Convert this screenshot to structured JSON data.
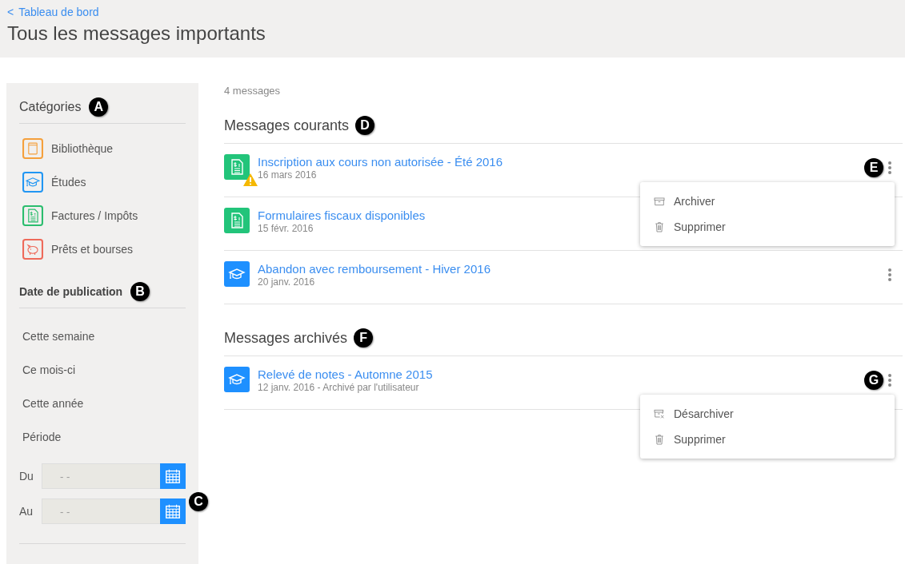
{
  "header": {
    "back_link": "Tableau de bord",
    "back_icon": "<",
    "title": "Tous les messages importants"
  },
  "sidebar": {
    "categories": {
      "title": "Catégories",
      "callout": "A",
      "items": [
        {
          "label": "Bibliothèque",
          "kind": "book",
          "color": "#f5a03c"
        },
        {
          "label": "Études",
          "kind": "cap",
          "color": "#2196f3"
        },
        {
          "label": "Factures / Impôts",
          "kind": "invoice",
          "color": "#2bbd6e"
        },
        {
          "label": "Prêts et bourses",
          "kind": "piggy",
          "color": "#ee6a5a"
        }
      ]
    },
    "date": {
      "title": "Date de publication",
      "callout": "B",
      "options": [
        "Cette semaine",
        "Ce mois-ci",
        "Cette année",
        "Période"
      ],
      "fields": [
        {
          "label": "Du",
          "placeholder": "- -"
        },
        {
          "label": "Au",
          "placeholder": "- -"
        }
      ],
      "fields_callout": "C"
    }
  },
  "main": {
    "count": "4 messages",
    "sections": [
      {
        "title": "Messages courants",
        "callout": "D",
        "messages": [
          {
            "title": "Inscription aux cours non autorisée - Été 2016",
            "meta": "16 mars 2016",
            "kind": "invoice",
            "warning": true,
            "callout": "E",
            "menu": [
              {
                "kind": "archive",
                "label": "Archiver"
              },
              {
                "kind": "delete",
                "label": "Supprimer"
              }
            ]
          },
          {
            "title": "Formulaires fiscaux disponibles",
            "meta": "15 févr. 2016",
            "kind": "invoice",
            "warning": false
          },
          {
            "title": "Abandon avec remboursement - Hiver 2016",
            "meta": "20 janv. 2016",
            "kind": "cap",
            "warning": false
          }
        ]
      },
      {
        "title": "Messages archivés",
        "callout": "F",
        "messages": [
          {
            "title": "Relevé de notes - Automne 2015",
            "meta": "12 janv. 2016 - Archivé par l'utilisateur",
            "kind": "cap",
            "warning": false,
            "callout": "G",
            "menu": [
              {
                "kind": "unarchive",
                "label": "Désarchiver"
              },
              {
                "kind": "delete",
                "label": "Supprimer"
              }
            ]
          }
        ]
      }
    ]
  }
}
